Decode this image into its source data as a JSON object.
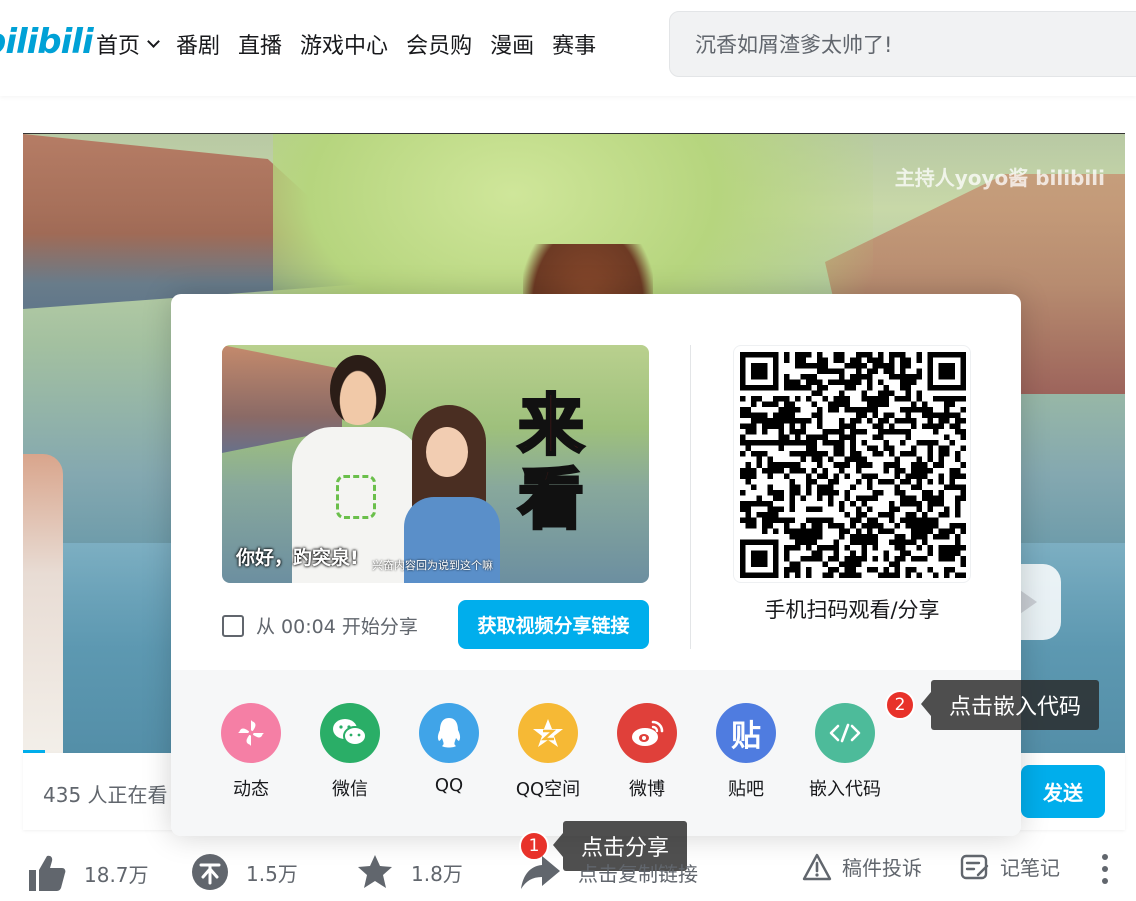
{
  "header": {
    "logo": "bilibili",
    "nav": [
      {
        "label": "首页",
        "has_dropdown": true
      },
      {
        "label": "番剧"
      },
      {
        "label": "直播"
      },
      {
        "label": "游戏中心"
      },
      {
        "label": "会员购"
      },
      {
        "label": "漫画"
      },
      {
        "label": "赛事"
      }
    ],
    "search_placeholder": "沉香如屑渣爹太帅了!"
  },
  "video": {
    "watermark": "主持人yoyo酱 bilibili"
  },
  "danmaku": {
    "viewers": "435 人正在看",
    "send_label": "发送"
  },
  "share": {
    "thumbnail": {
      "big_chars": [
        "来",
        "看"
      ],
      "caption": "你好，趵突泉!",
      "subcaption": "兴奋内容回为说到这个嘛"
    },
    "start_from_label": "从 00:04 开始分享",
    "get_link_label": "获取视频分享链接",
    "qr_caption": "手机扫码观看/分享",
    "platforms": [
      {
        "label": "动态",
        "icon": "pinwheel-icon",
        "color": "#f57fa5"
      },
      {
        "label": "微信",
        "icon": "wechat-icon",
        "color": "#2aae67"
      },
      {
        "label": "QQ",
        "icon": "qq-penguin-icon",
        "color": "#40a4e8"
      },
      {
        "label": "QQ空间",
        "icon": "qzone-star-icon",
        "color": "#f6b935"
      },
      {
        "label": "微博",
        "icon": "weibo-icon",
        "color": "#e0403a"
      },
      {
        "label": "贴吧",
        "icon": "tieba-icon",
        "color": "#4f7ce0"
      },
      {
        "label": "嵌入代码",
        "icon": "code-icon",
        "color": "#4dbb9a"
      }
    ]
  },
  "tooltips": [
    {
      "num": "1",
      "text": "点击分享"
    },
    {
      "num": "2",
      "text": "点击嵌入代码"
    }
  ],
  "toolbar": {
    "like": "18.7万",
    "coin": "1.5万",
    "favorite": "1.8万",
    "share": "点击复制链接",
    "report": "稿件投诉",
    "note": "记笔记"
  },
  "colors": {
    "brand": "#00aeec",
    "tooltip_badge": "#e8322a"
  }
}
